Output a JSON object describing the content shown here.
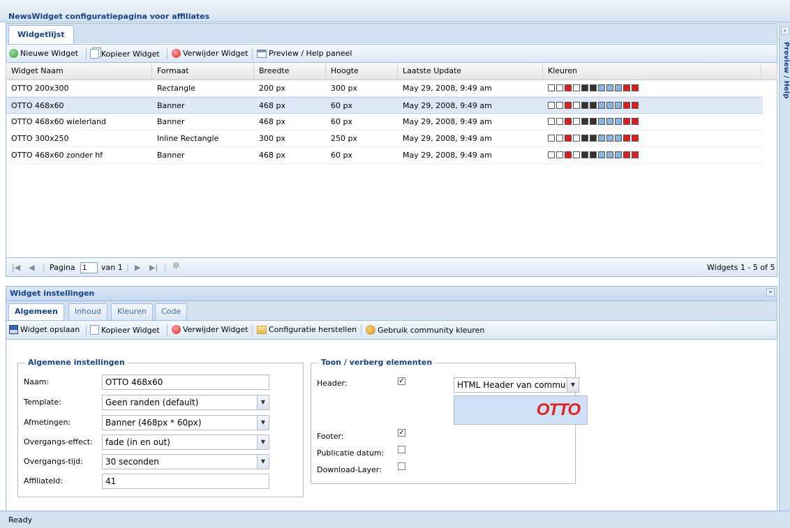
{
  "app": {
    "title": "NewsWidget configuratiepagina voor affiliates"
  },
  "east": {
    "label": "Preview / Help"
  },
  "top_panel": {
    "tab": "Widgetlijst",
    "toolbar": {
      "new": "Nieuwe Widget",
      "copy": "Kopieer Widget",
      "delete": "Verwijder Widget",
      "preview": "Preview / Help paneel"
    },
    "grid": {
      "columns": [
        "Widget Naam",
        "Formaat",
        "Breedte",
        "Hoogte",
        "Laatste Update",
        "Kleuren"
      ],
      "rows": [
        {
          "name": "OTTO 200x300",
          "format": "Rectangle",
          "width": "200 px",
          "height": "300 px",
          "updated": "May 29, 2008, 9:49 am"
        },
        {
          "name": "OTTO 468x60",
          "format": "Banner",
          "width": "468 px",
          "height": "60 px",
          "updated": "May 29, 2008, 9:49 am"
        },
        {
          "name": "OTTO 468x60 wielerland",
          "format": "Banner",
          "width": "468 px",
          "height": "60 px",
          "updated": "May 29, 2008, 9:49 am"
        },
        {
          "name": "OTTO 300x250",
          "format": "Inline Rectangle",
          "width": "300 px",
          "height": "250 px",
          "updated": "May 29, 2008, 9:49 am"
        },
        {
          "name": "OTTO 468x60 zonder hf",
          "format": "Banner",
          "width": "468 px",
          "height": "60 px",
          "updated": "May 29, 2008, 9:49 am"
        }
      ],
      "swatch_colors": [
        "#ffffff",
        "#ffffff",
        "#e21b1b",
        "#ffffff",
        "#333333",
        "#333333",
        "#8ab3e0",
        "#8ab3e0",
        "#8ab3e0",
        "#e21b1b",
        "#e21b1b"
      ]
    },
    "pager": {
      "page_label": "Pagina",
      "page_value": "1",
      "of_label": "van 1",
      "summary": "Widgets 1 - 5 of 5"
    }
  },
  "bottom_panel": {
    "title": "Widget instellingen",
    "tabs": [
      "Algemeen",
      "Inhoud",
      "Kleuren",
      "Code"
    ],
    "toolbar": {
      "save": "Widget opslaan",
      "copy": "Kopieer Widget",
      "delete": "Verwijder Widget",
      "restore": "Configuratie herstellen",
      "community": "Gebruik community kleuren"
    },
    "general": {
      "legend": "Algemene instellingen",
      "name_label": "Naam:",
      "name_value": "OTTO 468x60",
      "template_label": "Template:",
      "template_value": "Geen randen (default)",
      "size_label": "Afmetingen:",
      "size_value": "Banner (468px * 60px)",
      "transition_label": "Overgangs-effect:",
      "transition_value": "fade (in en out)",
      "transition_time_label": "Overgangs-tijd:",
      "transition_time_value": "30 seconden",
      "affiliate_label": "AffiliateId:",
      "affiliate_value": "41"
    },
    "elements": {
      "legend": "Toon / verberg elementen",
      "header_label": "Header:",
      "header_checked": true,
      "header_select": "HTML Header van commu",
      "logo_text": "OTTO",
      "footer_label": "Footer:",
      "footer_checked": true,
      "pubdate_label": "Publicatie datum:",
      "pubdate_checked": false,
      "download_label": "Download-Layer:",
      "download_checked": false
    }
  },
  "status": {
    "text": "Ready"
  }
}
